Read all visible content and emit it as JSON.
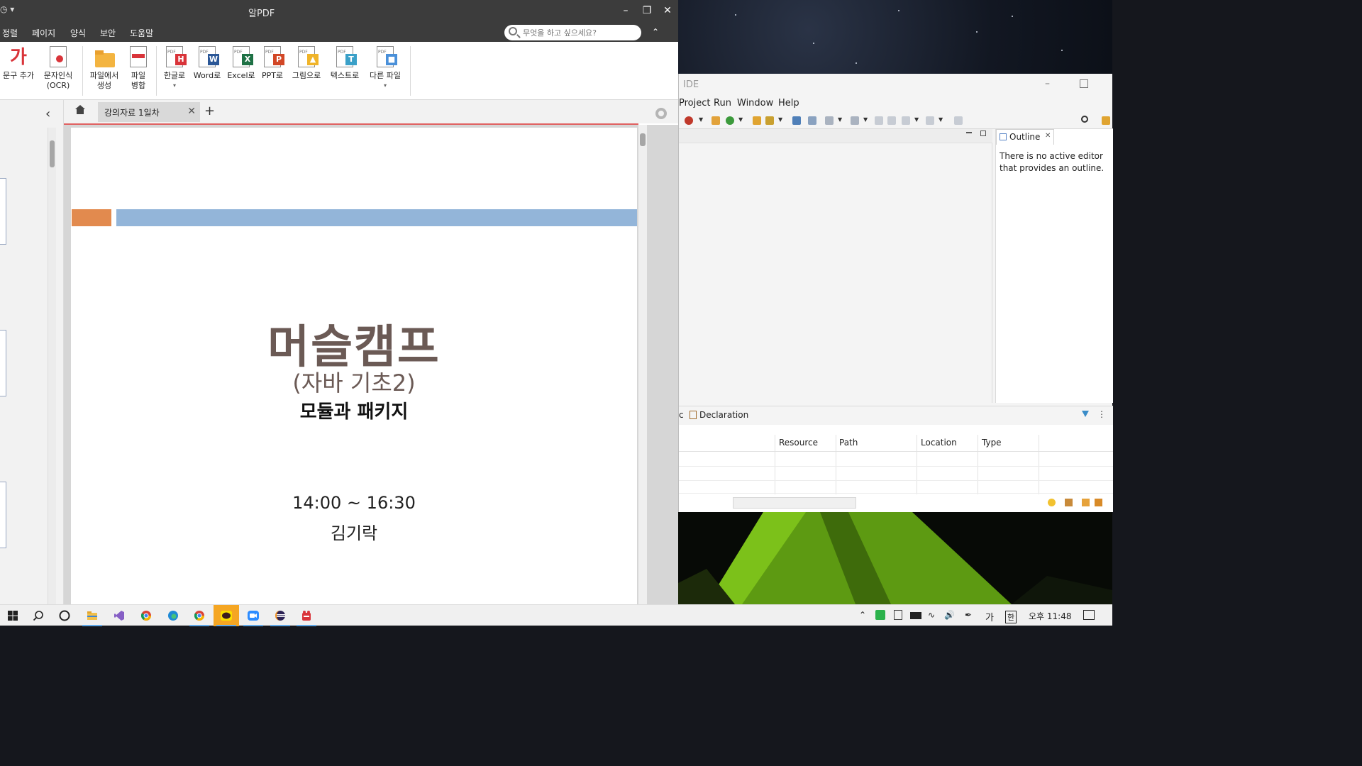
{
  "pdf_window": {
    "title": "알PDF",
    "menu": [
      "정렬",
      "페이지",
      "양식",
      "보안",
      "도움말"
    ],
    "search_placeholder": "무엇을 하고 싶으세요?",
    "ribbon": {
      "add_text": "문구 추가",
      "ocr_line1": "문자인식",
      "ocr_line2": "(OCR)",
      "create_line1": "파일에서",
      "create_line2": "생성",
      "merge_line1": "파일",
      "merge_line2": "병합",
      "to_hangul": "한글로",
      "to_word": "Word로",
      "to_excel": "Excel로",
      "to_ppt": "PPT로",
      "to_image": "그림으로",
      "to_text": "텍스트로",
      "to_other": "다른 파일"
    },
    "tab_label": "강의자료 1일차",
    "slide": {
      "title": "머슬캠프",
      "subtitle": "(자바 기초2)",
      "topic": "모듈과 패키지",
      "time": "14:00 ~ 16:30",
      "presenter": "김기락"
    }
  },
  "ide_window": {
    "title": "IDE",
    "menu": [
      "Project",
      "Run",
      "Window",
      "Help"
    ],
    "outline_tab": "Outline",
    "outline_message": "There is no active editor that provides an outline.",
    "bottom_panel": {
      "truncated_tab": "c",
      "declaration_tab": "Declaration",
      "columns": [
        "Resource",
        "Path",
        "Location",
        "Type"
      ]
    }
  },
  "taskbar": {
    "tray": {
      "ime_lang": "가",
      "ime_mode": "한",
      "clock": "오후 11:48"
    }
  },
  "colors": {
    "pdf_titlebar": "#3c3c3c",
    "slide_orange": "#e28a4e",
    "slide_blue": "#93b5d9",
    "slide_title": "#6b5a55"
  }
}
